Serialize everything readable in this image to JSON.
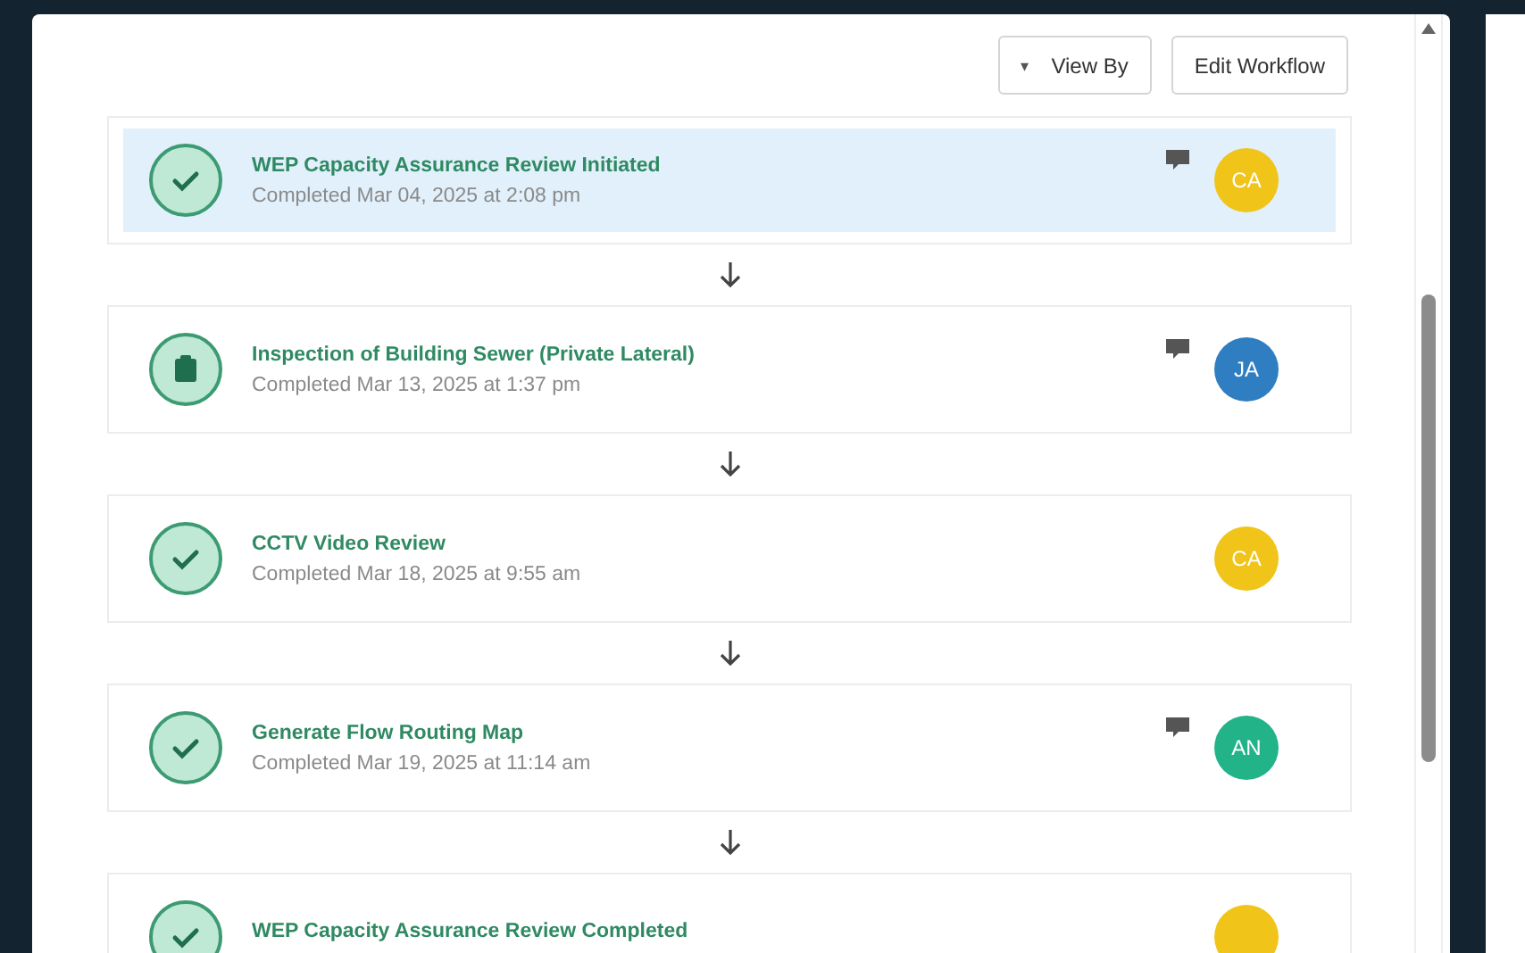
{
  "toolbar": {
    "view_by": {
      "caret": "▾",
      "label": "View By"
    },
    "edit_button": "Edit Workflow"
  },
  "steps": [
    {
      "title": "WEP Capacity Assurance Review Initiated",
      "subtitle": "Completed Mar 04, 2025 at 2:08 pm",
      "kind": "check",
      "selected": true,
      "comment": true,
      "avatar": "CA",
      "color": "#f0c419"
    },
    {
      "title": "Inspection of Building Sewer (Private Lateral)",
      "subtitle": "Completed Mar 13, 2025 at 1:37 pm",
      "kind": "clipboard",
      "selected": false,
      "comment": true,
      "avatar": "JA",
      "color": "#2f7ec1"
    },
    {
      "title": "CCTV Video Review",
      "subtitle": "Completed Mar 18, 2025 at 9:55 am",
      "kind": "check",
      "selected": false,
      "comment": false,
      "avatar": "CA",
      "color": "#f0c419"
    },
    {
      "title": "Generate Flow Routing Map",
      "subtitle": "Completed Mar 19, 2025 at 11:14 am",
      "kind": "check",
      "selected": false,
      "comment": true,
      "avatar": "AN",
      "color": "#22b388"
    },
    {
      "title": "WEP Capacity Assurance Review Completed",
      "kind": "check",
      "selected": false,
      "color": "#f0c419"
    }
  ]
}
